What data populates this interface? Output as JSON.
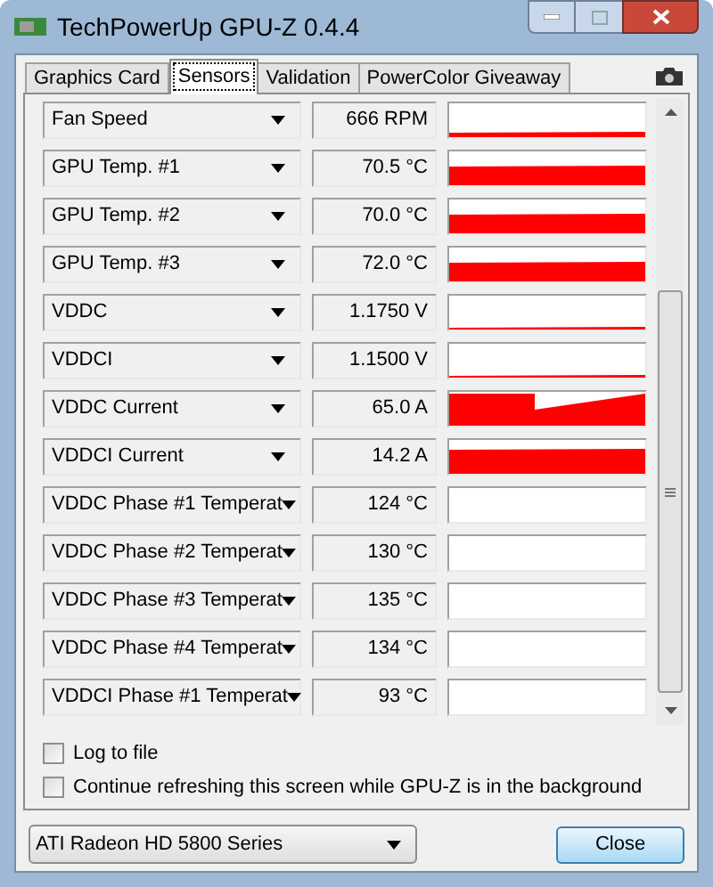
{
  "window": {
    "title": "TechPowerUp GPU-Z 0.4.4"
  },
  "tabs": [
    {
      "label": "Graphics Card",
      "selected": false
    },
    {
      "label": "Sensors",
      "selected": true
    },
    {
      "label": "Validation",
      "selected": false
    },
    {
      "label": "PowerColor Giveaway",
      "selected": false
    }
  ],
  "sensors": [
    {
      "name": "Fan Speed",
      "value": "666 RPM",
      "kind": "low"
    },
    {
      "name": "GPU Temp. #1",
      "value": "70.5 °C",
      "kind": "mid"
    },
    {
      "name": "GPU Temp. #2",
      "value": "70.0 °C",
      "kind": "mid"
    },
    {
      "name": "GPU Temp. #3",
      "value": "72.0 °C",
      "kind": "mid"
    },
    {
      "name": "VDDC",
      "value": "1.1750 V",
      "kind": "trace"
    },
    {
      "name": "VDDCI",
      "value": "1.1500 V",
      "kind": "trace"
    },
    {
      "name": "VDDC Current",
      "value": "65.0 A",
      "kind": "step"
    },
    {
      "name": "VDDCI Current",
      "value": "14.2 A",
      "kind": "high"
    },
    {
      "name": "VDDC Phase #1 Temperat",
      "value": "124 °C",
      "kind": "empty"
    },
    {
      "name": "VDDC Phase #2 Temperat",
      "value": "130 °C",
      "kind": "empty"
    },
    {
      "name": "VDDC Phase #3 Temperat",
      "value": "135 °C",
      "kind": "empty"
    },
    {
      "name": "VDDC Phase #4 Temperat",
      "value": "134 °C",
      "kind": "empty"
    },
    {
      "name": "VDDCI Phase #1 Temperat",
      "value": "93 °C",
      "kind": "empty"
    }
  ],
  "options": [
    {
      "label": "Log to file",
      "checked": false
    },
    {
      "label": "Continue refreshing this screen while GPU-Z is in the background",
      "checked": false
    }
  ],
  "gpu_select": {
    "value": "ATI Radeon HD 5800 Series"
  },
  "close_button": {
    "label": "Close"
  }
}
